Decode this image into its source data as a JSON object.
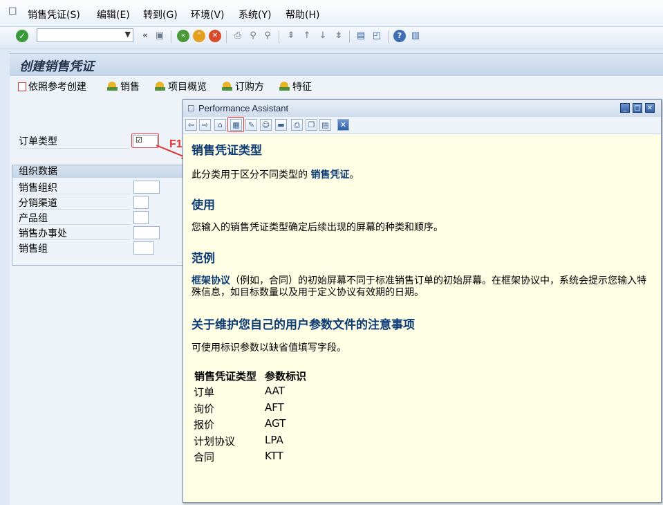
{
  "menubar": {
    "items": [
      "销售凭证(S)",
      "编辑(E)",
      "转到(G)",
      "环境(V)",
      "系统(Y)",
      "帮助(H)"
    ]
  },
  "toolbar": {
    "command_value": "",
    "back_chevron": "«"
  },
  "page": {
    "title": "创建销售凭证"
  },
  "app_toolbar": {
    "buttons": [
      "依照参考创建",
      "销售",
      "项目概览",
      "订购方",
      "特征"
    ]
  },
  "form": {
    "order_type_label": "订单类型",
    "order_type_value": "",
    "org_group_title": "组织数据",
    "org_fields": [
      "销售组织",
      "分销渠道",
      "产品组",
      "销售办事处",
      "销售组"
    ]
  },
  "annotation": {
    "f1": "F1",
    "color": "#e53b3b"
  },
  "assistant": {
    "title": "Performance Assistant",
    "heading1": "销售凭证类型",
    "p1_prefix": "此分类用于区分不同类型的 ",
    "p1_link": "销售凭证",
    "p1_suffix": "。",
    "heading2": "使用",
    "p2": "您输入的销售凭证类型确定后续出现的屏幕的种类和顺序。",
    "heading3": "范例",
    "p3_link": "框架协议",
    "p3_text": "（例如，合同）的初始屏幕不同于标准销售订单的初始屏幕。在框架协议中，系统会提示您输入特殊信息，如目标数量以及用于定义协议有效期的日期。",
    "heading4": "关于维护您自己的用户参数文件的注意事项",
    "p4": "可使用标识参数以缺省值填写字段。",
    "table_headers": [
      "销售凭证类型",
      "参数标识"
    ],
    "table_rows": [
      [
        "订单",
        "AAT"
      ],
      [
        "询价",
        "AFT"
      ],
      [
        "报价",
        "AGT"
      ],
      [
        "计划协议",
        "LPA"
      ],
      [
        "合同",
        "KTT"
      ]
    ]
  },
  "colors": {
    "heading": "#0d3b75",
    "background": "#ffffe5",
    "accent_red": "#e53b3b"
  }
}
